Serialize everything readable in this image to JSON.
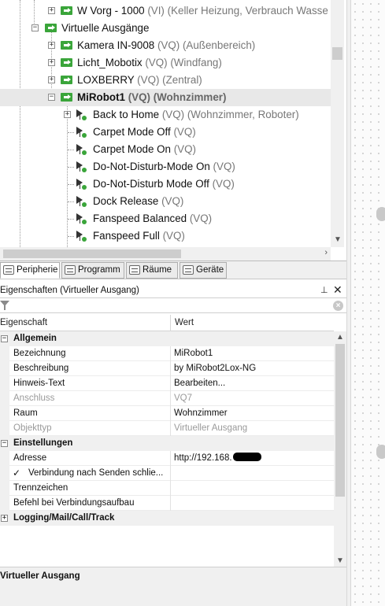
{
  "tree": {
    "rows": [
      {
        "name": "W Vorg - 1000",
        "suffix": " (VI) (Keller Heizung, Verbrauch Wasse"
      },
      {
        "name": "Virtuelle Ausgänge",
        "suffix": ""
      },
      {
        "name": "Kamera IN-9008",
        "suffix": " (VQ) (Außenbereich)"
      },
      {
        "name": "Licht_Mobotix",
        "suffix": " (VQ) (Windfang)"
      },
      {
        "name": "LOXBERRY",
        "suffix": " (VQ) (Zentral)"
      },
      {
        "name": "MiRobot1",
        "suffix": " (VQ) (Wohnzimmer)"
      },
      {
        "name": "Back to Home",
        "suffix": " (VQ) (Wohnzimmer, Roboter)"
      },
      {
        "name": "Carpet Mode Off",
        "suffix": " (VQ)"
      },
      {
        "name": "Carpet Mode On",
        "suffix": " (VQ)"
      },
      {
        "name": "Do-Not-Disturb-Mode On",
        "suffix": " (VQ)"
      },
      {
        "name": "Do-Not-Disturb Mode Off",
        "suffix": " (VQ)"
      },
      {
        "name": "Dock Release",
        "suffix": " (VQ)"
      },
      {
        "name": "Fanspeed Balanced",
        "suffix": " (VQ)"
      },
      {
        "name": "Fanspeed Full",
        "suffix": " (VQ)"
      }
    ],
    "expand_glyphs": {
      "collapsed": "+",
      "expanded": "−"
    }
  },
  "tabs": [
    {
      "label": "Peripherie",
      "active": true
    },
    {
      "label": "Programm",
      "active": false
    },
    {
      "label": "Räume",
      "active": false
    },
    {
      "label": "Geräte",
      "active": false
    }
  ],
  "properties": {
    "panel_title": "Eigenschaften (Virtueller Ausgang)",
    "pin_glyph": "⊥",
    "close_glyph": "✕",
    "filter_value": "",
    "filter_clear_glyph": "×",
    "col_property": "Eigenschaft",
    "col_value": "Wert",
    "categories": {
      "allgemein": "Allgemein",
      "einstellungen": "Einstellungen",
      "logging": "Logging/Mail/Call/Track"
    },
    "rows": {
      "bezeichnung": {
        "name": "Bezeichnung",
        "value": "MiRobot1"
      },
      "beschreibung": {
        "name": "Beschreibung",
        "value": "by MiRobot2Lox-NG"
      },
      "hinweis": {
        "name": "Hinweis-Text",
        "value": "Bearbeiten..."
      },
      "anschluss": {
        "name": "Anschluss",
        "value": "VQ7"
      },
      "raum": {
        "name": "Raum",
        "value": "Wohnzimmer"
      },
      "objekttyp": {
        "name": "Objekttyp",
        "value": "Virtueller Ausgang"
      },
      "adresse": {
        "name": "Adresse",
        "value": "http://192.168."
      },
      "verbindung": {
        "name": "Verbindung nach Senden schlie...",
        "checked": true,
        "check_glyph": "✓"
      },
      "trennzeichen": {
        "name": "Trennzeichen",
        "value": ""
      },
      "befehl": {
        "name": "Befehl bei Verbindungsaufbau",
        "value": ""
      }
    },
    "description_title": "Virtueller Ausgang"
  },
  "colors": {
    "accent_green": "#3aa53a",
    "selection": "#e8e8e8",
    "dim_text": "#777777"
  }
}
